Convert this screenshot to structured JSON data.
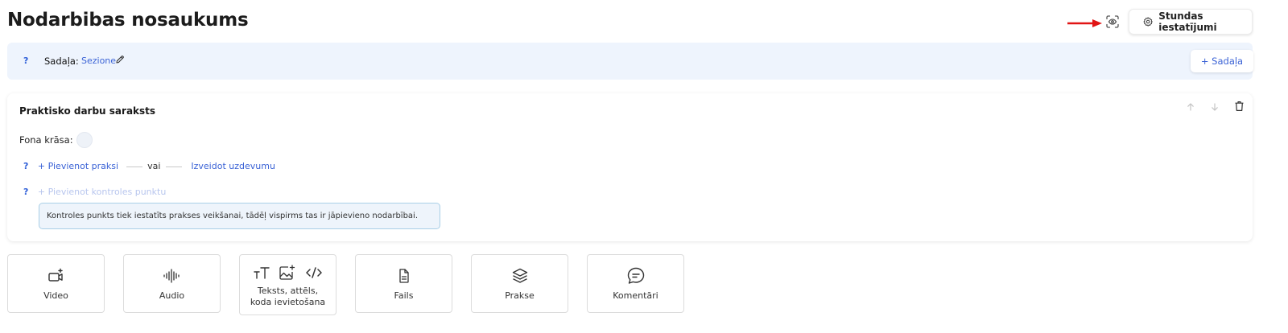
{
  "header": {
    "title": "Nodarbibas nosaukums",
    "preview_icon": "eye-scan-icon",
    "settings_icon": "gear-icon",
    "settings_label": "Stundas iestatījumi"
  },
  "section_bar": {
    "help": "?",
    "label": "Sadaļa:",
    "name": "Sezione",
    "edit_icon": "pencil-icon",
    "add_button": "+ Sadaļa"
  },
  "practice_card": {
    "title": "Praktisko darbu saraksts",
    "tools": [
      "arrow-up-icon",
      "arrow-down-icon",
      "trash-icon"
    ],
    "background_label": "Fona krāsa:",
    "background_color": "#eef2f8",
    "help": "?",
    "add_practice": "+ Pievienot praksi",
    "or": "vai",
    "create_task": "Izveidot uzdevumu",
    "add_checkpoint": "+ Pievienot kontroles punktu",
    "info": "Kontroles punkts tiek iestatīts prakses veikšanai, tādēļ vispirms tas ir jāpievieno nodarbībai."
  },
  "blocks": [
    {
      "label": "Video",
      "icon": "video-add-icon"
    },
    {
      "label": "Audio",
      "icon": "audio-wave-icon"
    },
    {
      "label": "Teksts, attēls, koda ievietošana",
      "icons": [
        "text-size-icon",
        "image-add-icon",
        "code-icon"
      ]
    },
    {
      "label": "Fails",
      "icon": "file-icon"
    },
    {
      "label": "Prakse",
      "icon": "layers-icon"
    },
    {
      "label": "Komentāri",
      "icon": "comment-icon"
    }
  ],
  "colors": {
    "accent": "#3b63d6",
    "section_bg": "#eef4fd",
    "info_bg": "#eef4fb",
    "info_border": "#a9cfe6",
    "annotation_arrow": "#e11414"
  }
}
